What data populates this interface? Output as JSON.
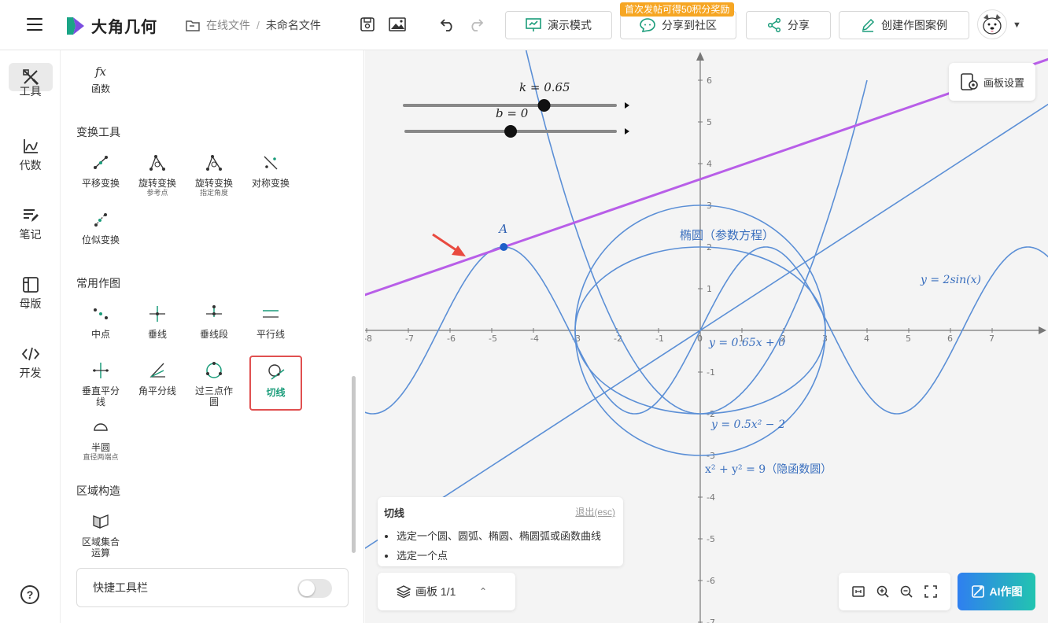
{
  "header": {
    "logo_text": "大角几何",
    "breadcrumb_parent": "在线文件",
    "breadcrumb_separator": "/",
    "breadcrumb_current": "未命名文件",
    "present_label": "演示模式",
    "share_community_label": "分享到社区",
    "promo_badge": "首次发帖可得50积分奖励",
    "share_label": "分享",
    "create_case_label": "创建作图案例"
  },
  "rail": {
    "items": [
      {
        "label": "工具",
        "icon": "tools-icon"
      },
      {
        "label": "代数",
        "icon": "algebra-icon"
      },
      {
        "label": "笔记",
        "icon": "notes-icon"
      },
      {
        "label": "母版",
        "icon": "template-icon"
      },
      {
        "label": "开发",
        "icon": "code-icon"
      }
    ],
    "help": "?"
  },
  "panel": {
    "function_tool": {
      "icon_text": "fx",
      "label": "函数"
    },
    "sections": {
      "transform": "变换工具",
      "common": "常用作图",
      "region": "区域构造"
    },
    "transform_tools": [
      {
        "label": "平移变换",
        "sub": ""
      },
      {
        "label": "旋转变换",
        "sub": "参考点"
      },
      {
        "label": "旋转变换",
        "sub": "指定角度"
      },
      {
        "label": "对称变换",
        "sub": ""
      },
      {
        "label": "位似变换",
        "sub": ""
      }
    ],
    "common_tools": [
      {
        "label": "中点",
        "sub": ""
      },
      {
        "label": "垂线",
        "sub": ""
      },
      {
        "label": "垂线段",
        "sub": ""
      },
      {
        "label": "平行线",
        "sub": ""
      },
      {
        "label": "垂直平分线",
        "sub": ""
      },
      {
        "label": "角平分线",
        "sub": ""
      },
      {
        "label": "过三点作圆",
        "sub": ""
      },
      {
        "label": "切线",
        "sub": ""
      },
      {
        "label": "半圆",
        "sub": "直径两端点"
      }
    ],
    "region_tools": [
      {
        "label": "区域集合运算",
        "sub": ""
      }
    ],
    "quickbar_label": "快捷工具栏",
    "quickbar_enabled": false
  },
  "canvas": {
    "board_settings_label": "画板设置",
    "sliders": [
      {
        "label": "k = 0.65",
        "value": 0.65,
        "min": -2,
        "max": 2
      },
      {
        "label": "b = 0",
        "value": 0,
        "min": -4,
        "max": 4
      }
    ],
    "point_label": "A",
    "curve_labels": {
      "ellipse": "椭圆（参数方程）",
      "sine": "y = 2sin(x)",
      "line": "y = 0.65x + 0",
      "parabola": "y = 0.5x² − 2",
      "circle": "x² + y² = 9（隐函数圆）"
    },
    "x_ticks": [
      "-8",
      "-7",
      "-6",
      "-5",
      "-4",
      "-3",
      "-2",
      "-1",
      "0",
      "1",
      "2",
      "3",
      "4",
      "5",
      "6",
      "7"
    ],
    "y_ticks": [
      "6",
      "5",
      "4",
      "3",
      "2",
      "1",
      "-1",
      "-2",
      "-3",
      "-4",
      "-5",
      "-6",
      "-7"
    ],
    "colors": {
      "curve": "#5b8fd6",
      "tangent": "#b85ee8",
      "arrow": "#e94a3f"
    }
  },
  "hint": {
    "title": "切线",
    "exit": "退出(esc)",
    "steps": [
      "选定一个圆、圆弧、椭圆、椭圆弧或函数曲线",
      "选定一个点"
    ]
  },
  "pages": {
    "label": "画板 1/1"
  },
  "ai_button": "AI作图"
}
